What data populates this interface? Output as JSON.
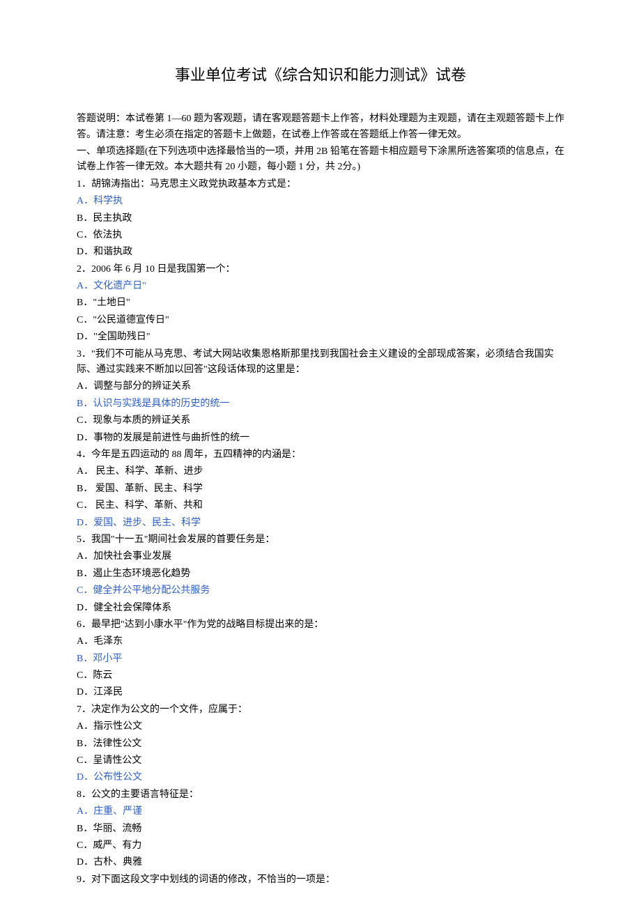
{
  "title": "事业单位考试《综合知识和能力测试》试卷",
  "instructions": "答题说明：本试卷第 1—60 题为客观题，请在客观题答题卡上作答，材料处理题为主观题，请在主观题答题卡上作答。请注意：考生必须在指定的答题卡上做题，在试卷上作答或在答题纸上作答一律无效。",
  "section1_header": "一、单项选择题(在下列选项中选择最恰当的一项，并用 2B 铅笔在答题卡相应题号下涂黑所选答案项的信息点，在试卷上作答一律无效。本大题共有 20 小题，每小题 1 分，共 2分。)",
  "q1": {
    "text": "1．胡锦涛指出：马克思主义政党执政基本方式是：",
    "a": "A．科学执",
    "b": "B．民主执政",
    "c": "C．依法执",
    "d": "D．和谐执政"
  },
  "q2": {
    "text": "2．2006 年 6 月 10 日是我国第一个：",
    "a": "A．文化遗产日\"",
    "b": "B．\"土地日\"",
    "c": "C．\"公民道德宣传日\"",
    "d": "D．\"全国助残日\""
  },
  "q3": {
    "text": "3．\"我们不可能从马克思、考试大网站收集恩格斯那里找到我国社会主义建设的全部现成答案，必须结合我国实际、通过实践来不断加以回答\"这段话体现的这里是：",
    "a": " A．调整与部分的辨证关系",
    "b": "B．认识与实践是具体的历史的统一",
    "c": "C．现象与本质的辨证关系",
    "d": "D．事物的发展是前进性与曲折性的统一"
  },
  "q4": {
    "text": "4．今年是五四运动的 88 周年，五四精神的内涵是：",
    "a": "A．  民主、科学、革新、进步",
    "b": "B．  爱国、革新、民主、科学",
    "c": "C．  民主、科学、革新、共和",
    "d": "D．爱国、进步、民主、科学"
  },
  "q5": {
    "text": "5．我国\"十一五\"期间社会发展的首要任务是：",
    "a": "A．加快社会事业发展",
    "b": "B．遏止生态环境恶化趋势",
    "c": "C．健全并公平地分配公共服务",
    "d": "D．健全社会保障体系"
  },
  "q6": {
    "text": "6．最早把\"达到小康水平\"作为党的战略目标提出来的是：",
    "a": "A．毛泽东",
    "b": "B．邓小平",
    "c": "C．陈云",
    "d": "D．江泽民"
  },
  "q7": {
    "text": "7．决定作为公文的一个文件，应属于：",
    "a": "A．指示性公文",
    "b": "B．法律性公文",
    "c": "C．呈请性公文",
    "d": "D．公布性公文"
  },
  "q8": {
    "text": "8．公文的主要语言特征是：",
    "a": "A．庄重、严谨",
    "b": "B．华丽、流畅",
    "c": "C．威严、有力",
    "d": "D．古朴、典雅"
  },
  "q9": {
    "text": "9．对下面这段文字中划线的词语的修改，不恰当的一项是："
  }
}
